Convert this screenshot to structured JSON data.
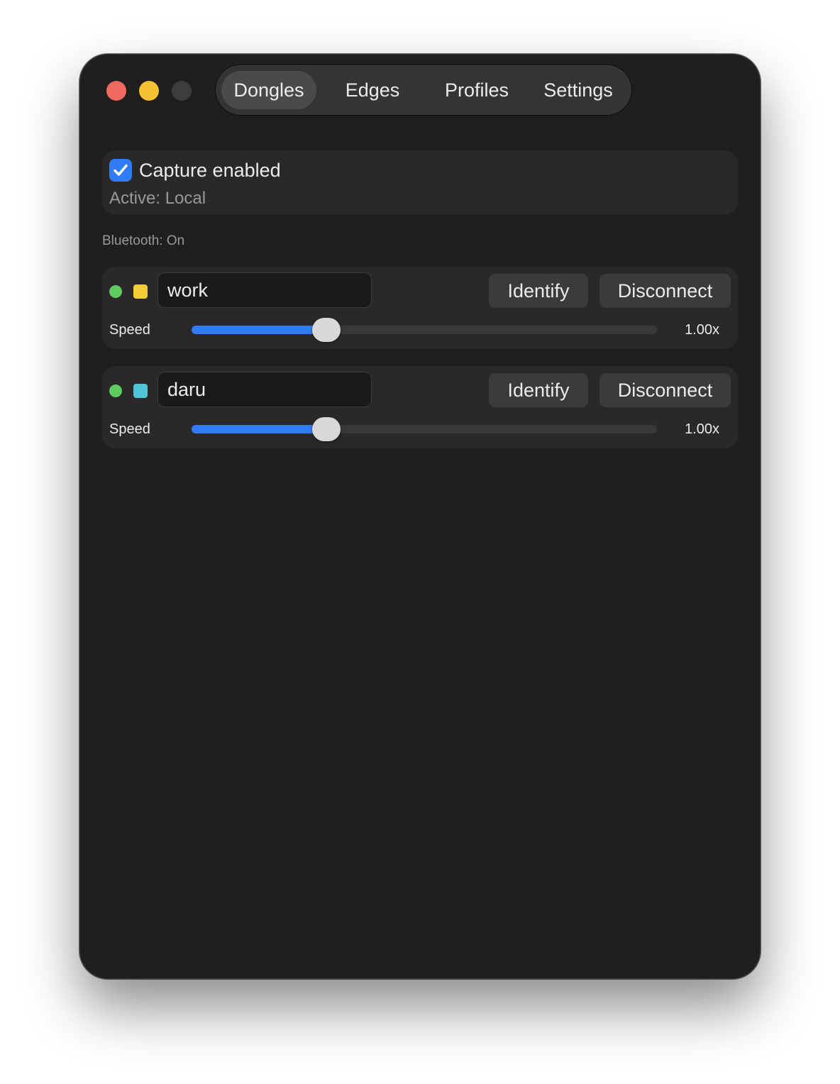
{
  "tabs": [
    {
      "label": "Dongles",
      "active": true
    },
    {
      "label": "Edges",
      "active": false
    },
    {
      "label": "Profiles",
      "active": false
    },
    {
      "label": "Settings",
      "active": false
    }
  ],
  "capture": {
    "label": "Capture enabled",
    "checked": true,
    "active_text": "Active: Local"
  },
  "bluetooth_status": "Bluetooth: On",
  "devices": [
    {
      "name": "work",
      "status_color": "#5ecb5e",
      "swatch_color": "#f4cd37",
      "identify_label": "Identify",
      "disconnect_label": "Disconnect",
      "speed_label": "Speed",
      "speed_value": "1.00x",
      "speed_fraction": 0.29
    },
    {
      "name": "daru",
      "status_color": "#5ecb5e",
      "swatch_color": "#4ec4d8",
      "identify_label": "Identify",
      "disconnect_label": "Disconnect",
      "speed_label": "Speed",
      "speed_value": "1.00x",
      "speed_fraction": 0.29
    }
  ],
  "colors": {
    "accent": "#2f7cf6",
    "window_bg": "#201e1f",
    "card_bg": "#2a2829",
    "traffic_close": "#ee6a5e",
    "traffic_minimize": "#f5c331",
    "traffic_zoom": "#3e3c3d"
  }
}
